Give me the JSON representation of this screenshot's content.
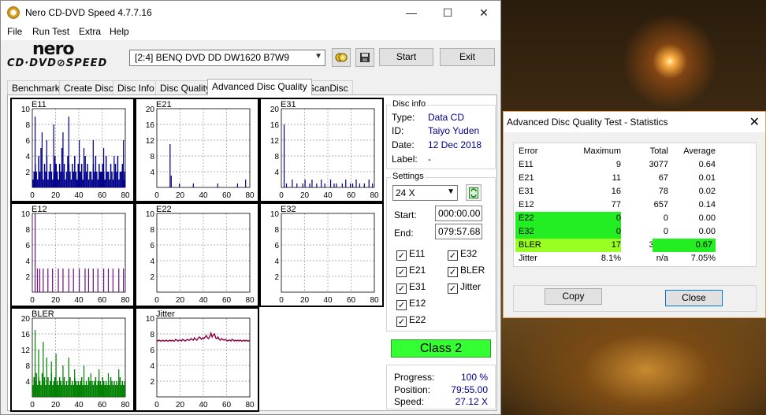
{
  "window": {
    "title": "Nero CD-DVD Speed 4.7.7.16",
    "controls": {
      "minimize": "—",
      "maximize": "☐",
      "close": "✕"
    }
  },
  "menu": [
    "File",
    "Run Test",
    "Extra",
    "Help"
  ],
  "logo": {
    "line1": "nero",
    "line2": "CD·DVD⊘SPEED"
  },
  "toolbar": {
    "drive": "[2:4]   BENQ DVD DD DW1620 B7W9",
    "start_label": "Start",
    "exit_label": "Exit"
  },
  "tabs": [
    "Benchmark",
    "Create Disc",
    "Disc Info",
    "Disc Quality",
    "Advanced Disc Quality",
    "ScanDisc"
  ],
  "active_tab": "Advanced Disc Quality",
  "disc_info": {
    "title": "Disc info",
    "type_label": "Type:",
    "type": "Data CD",
    "id_label": "ID:",
    "id": "Taiyo Yuden",
    "date_label": "Date:",
    "date": "12 Dec 2018",
    "label_label": "Label:",
    "label": "-"
  },
  "settings": {
    "title": "Settings",
    "speed": "24 X",
    "start_label": "Start:",
    "start": "000:00.00",
    "end_label": "End:",
    "end": "079:57.68",
    "checks": [
      {
        "label": "E11",
        "checked": true
      },
      {
        "label": "E32",
        "checked": true
      },
      {
        "label": "E21",
        "checked": true
      },
      {
        "label": "BLER",
        "checked": true
      },
      {
        "label": "E31",
        "checked": true
      },
      {
        "label": "Jitter",
        "checked": true
      },
      {
        "label": "E12",
        "checked": true
      },
      {
        "label": "E22",
        "checked": true
      }
    ]
  },
  "class_label": "Class 2",
  "progress": {
    "progress_label": "Progress:",
    "progress": "100 %",
    "position_label": "Position:",
    "position": "79:55.00",
    "speed_label": "Speed:",
    "speed": "27.12 X"
  },
  "chart_data": [
    {
      "type": "bar",
      "title": "E11",
      "xlim": [
        0,
        80
      ],
      "ylim": [
        0,
        10
      ],
      "yticks": [
        "10",
        "8",
        "6",
        "4",
        "2"
      ],
      "xticks": [
        "0",
        "20",
        "40",
        "60",
        "80"
      ],
      "color": "#00008a",
      "baseline": [
        1,
        2,
        3,
        2,
        1,
        4,
        2,
        5,
        2,
        1,
        3,
        2,
        4,
        1,
        2,
        3,
        2,
        1,
        2,
        4,
        3,
        2,
        1,
        3,
        2,
        5,
        2,
        3,
        1,
        2,
        4,
        3,
        2,
        1,
        3,
        2,
        4,
        2,
        1,
        3,
        2,
        2,
        3,
        1,
        2,
        4,
        2,
        3,
        1,
        2,
        2,
        1,
        3,
        2,
        4,
        2,
        1,
        3,
        2,
        2,
        3,
        2,
        1,
        4,
        2,
        2,
        1,
        3,
        2,
        1,
        2,
        3,
        2,
        4,
        1,
        2,
        2,
        3,
        1,
        2
      ],
      "peaks": [
        [
          2,
          9
        ],
        [
          8,
          7
        ],
        [
          12,
          6
        ],
        [
          18,
          8
        ],
        [
          26,
          7
        ],
        [
          31,
          9
        ],
        [
          40,
          6
        ],
        [
          44,
          5
        ],
        [
          52,
          6
        ],
        [
          61,
          5
        ],
        [
          70,
          4
        ],
        [
          78,
          6
        ]
      ]
    },
    {
      "type": "bar",
      "title": "E21",
      "xlim": [
        0,
        80
      ],
      "ylim": [
        0,
        20
      ],
      "yticks": [
        "20",
        "16",
        "12",
        "8",
        "4"
      ],
      "xticks": [
        "0",
        "20",
        "40",
        "60",
        "80"
      ],
      "color": "#00008a",
      "peaks": [
        [
          11,
          11
        ],
        [
          12,
          3
        ],
        [
          19,
          1
        ],
        [
          31,
          1
        ],
        [
          52,
          1
        ],
        [
          69,
          1
        ],
        [
          76,
          2
        ]
      ]
    },
    {
      "type": "bar",
      "title": "E31",
      "xlim": [
        0,
        80
      ],
      "ylim": [
        0,
        20
      ],
      "yticks": [
        "20",
        "16",
        "12",
        "8",
        "4"
      ],
      "xticks": [
        "0",
        "20",
        "40",
        "60",
        "80"
      ],
      "color": "#00008a",
      "peaks": [
        [
          2,
          16
        ],
        [
          4,
          1
        ],
        [
          9,
          2
        ],
        [
          13,
          1
        ],
        [
          18,
          1
        ],
        [
          20,
          2
        ],
        [
          24,
          1
        ],
        [
          26,
          2
        ],
        [
          30,
          1
        ],
        [
          34,
          2
        ],
        [
          37,
          1
        ],
        [
          42,
          2
        ],
        [
          45,
          1
        ],
        [
          47,
          1
        ],
        [
          52,
          1
        ],
        [
          55,
          2
        ],
        [
          59,
          1
        ],
        [
          61,
          1
        ],
        [
          64,
          2
        ],
        [
          67,
          1
        ],
        [
          71,
          1
        ],
        [
          75,
          2
        ],
        [
          78,
          1
        ]
      ]
    },
    {
      "type": "bar",
      "title": "E12",
      "xlim": [
        0,
        80
      ],
      "ylim": [
        0,
        10
      ],
      "yticks": [
        "10",
        "8",
        "6",
        "4",
        "2"
      ],
      "xticks": [
        "0",
        "20",
        "40",
        "60",
        "80"
      ],
      "color": "#6a1080",
      "peaks": [
        [
          2,
          10
        ],
        [
          4,
          3
        ],
        [
          6,
          3
        ],
        [
          9,
          3
        ],
        [
          13,
          3
        ],
        [
          17,
          3
        ],
        [
          22,
          3
        ],
        [
          26,
          3
        ],
        [
          31,
          3
        ],
        [
          35,
          3
        ],
        [
          40,
          3
        ],
        [
          45,
          3
        ],
        [
          48,
          3
        ],
        [
          52,
          3
        ],
        [
          56,
          3
        ],
        [
          61,
          3
        ],
        [
          65,
          3
        ],
        [
          69,
          3
        ],
        [
          74,
          3
        ],
        [
          78,
          3
        ]
      ]
    },
    {
      "type": "bar",
      "title": "E22",
      "xlim": [
        0,
        80
      ],
      "ylim": [
        0,
        10
      ],
      "yticks": [
        "10",
        "8",
        "6",
        "4",
        "2"
      ],
      "xticks": [
        "0",
        "20",
        "40",
        "60",
        "80"
      ],
      "color": "#00008a",
      "peaks": []
    },
    {
      "type": "bar",
      "title": "E32",
      "xlim": [
        0,
        80
      ],
      "ylim": [
        0,
        10
      ],
      "yticks": [
        "10",
        "8",
        "6",
        "4",
        "2"
      ],
      "xticks": [
        "0",
        "20",
        "40",
        "60",
        "80"
      ],
      "color": "#00008a",
      "peaks": []
    },
    {
      "type": "bar",
      "title": "BLER",
      "xlim": [
        0,
        80
      ],
      "ylim": [
        0,
        20
      ],
      "yticks": [
        "20",
        "16",
        "12",
        "8",
        "4"
      ],
      "xticks": [
        "0",
        "20",
        "40",
        "60",
        "80"
      ],
      "color": "#008000",
      "baseline": [
        3,
        5,
        4,
        6,
        3,
        5,
        4,
        3,
        6,
        4,
        5,
        3,
        4,
        5,
        3,
        4,
        6,
        3,
        4,
        5,
        3,
        4,
        3,
        5,
        4,
        3,
        4,
        5,
        3,
        4,
        3,
        4,
        5,
        3,
        4,
        3,
        5,
        4,
        3,
        4,
        3,
        4,
        5,
        3,
        4,
        3,
        4,
        3,
        5,
        4,
        3,
        4,
        3,
        4,
        5,
        3,
        4,
        3,
        4,
        3,
        5,
        4,
        3,
        4,
        3,
        4,
        3,
        5,
        4,
        3,
        4,
        3,
        4,
        3,
        4,
        5,
        3,
        4,
        3,
        4
      ],
      "peaks": [
        [
          2,
          17
        ],
        [
          5,
          12
        ],
        [
          9,
          14
        ],
        [
          12,
          10
        ],
        [
          16,
          9
        ],
        [
          20,
          11
        ],
        [
          26,
          8
        ],
        [
          31,
          10
        ],
        [
          36,
          7
        ],
        [
          44,
          8
        ],
        [
          50,
          6
        ],
        [
          57,
          7
        ],
        [
          65,
          6
        ],
        [
          74,
          7
        ]
      ]
    },
    {
      "type": "line",
      "title": "Jitter",
      "xlim": [
        0,
        80
      ],
      "ylim": [
        0,
        10
      ],
      "yticks": [
        "10",
        "8",
        "6",
        "4",
        "2"
      ],
      "xticks": [
        "0",
        "20",
        "40",
        "60",
        "80"
      ],
      "color": "#8a0040",
      "series": [
        {
          "values": [
            7.2,
            7.1,
            7.2,
            7.1,
            7.1,
            7.2,
            7.1,
            7.1,
            7.2,
            7.1,
            7.1,
            7.2,
            7.1,
            7.2,
            7.1,
            7.1,
            7.3,
            7.2,
            7.1,
            7.2,
            7.2,
            7.1,
            7.3,
            7.2,
            7.1,
            7.2,
            7.3,
            7.2,
            7.2,
            7.4,
            7.3,
            7.2,
            7.5,
            7.3,
            7.2,
            7.4,
            7.6,
            7.5,
            7.3,
            7.5,
            7.4,
            7.6,
            7.8,
            7.5,
            7.4,
            7.7,
            8.1,
            7.6,
            7.9,
            8.0,
            7.5,
            7.4,
            7.6,
            7.3,
            7.2,
            7.4,
            7.3,
            7.2,
            7.3,
            7.2,
            7.1,
            7.2,
            7.2,
            7.1,
            7.3,
            7.2,
            7.1,
            7.2,
            7.1,
            7.2,
            7.1,
            7.2,
            7.1,
            7.1,
            7.2,
            7.1,
            7.2,
            7.1,
            7.1,
            7.2
          ]
        }
      ]
    }
  ],
  "stats": {
    "title": "Advanced Disc Quality Test - Statistics",
    "headers": [
      "Error",
      "Maximum",
      "Total",
      "Average"
    ],
    "rows": [
      {
        "name": "E11",
        "max": "9",
        "total": "3077",
        "avg": "0.64",
        "hl_name": "",
        "hl_avg": ""
      },
      {
        "name": "E21",
        "max": "11",
        "total": "67",
        "avg": "0.01",
        "hl_name": "",
        "hl_avg": ""
      },
      {
        "name": "E31",
        "max": "16",
        "total": "78",
        "avg": "0.02",
        "hl_name": "",
        "hl_avg": ""
      },
      {
        "name": "E12",
        "max": "77",
        "total": "657",
        "avg": "0.14",
        "hl_name": "",
        "hl_avg": ""
      },
      {
        "name": "E22",
        "max": "0",
        "total": "0",
        "avg": "0.00",
        "hl_name": "#22ee22",
        "hl_avg": ""
      },
      {
        "name": "E32",
        "max": "0",
        "total": "0",
        "avg": "0.00",
        "hl_name": "#22ee22",
        "hl_avg": ""
      },
      {
        "name": "BLER",
        "max": "17",
        "total": "3222",
        "avg": "0.67",
        "hl_name": "#99ff22",
        "hl_avg": "#22ee22"
      },
      {
        "name": "Jitter",
        "max": "8.1%",
        "total": "n/a",
        "avg": "7.05%",
        "hl_name": "",
        "hl_avg": ""
      }
    ],
    "copy_label": "Copy",
    "close_label": "Close"
  }
}
